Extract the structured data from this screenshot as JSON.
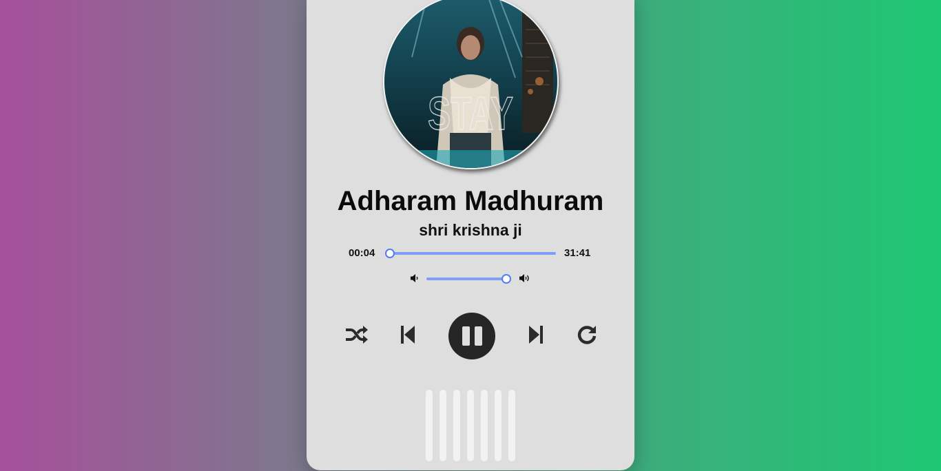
{
  "song": {
    "title": "Adharam Madhuram",
    "artist": "shri krishna ji",
    "cover_text": "STAY"
  },
  "progress": {
    "current": "00:04",
    "duration": "31:41",
    "fraction": 0.002
  },
  "volume": {
    "level": 1.0
  },
  "controls": [
    "shuffle-icon",
    "previous-icon",
    "pause-icon",
    "next-icon",
    "repeat-icon"
  ],
  "colors": {
    "accent": "#4f7ef0",
    "track": "#7f9ff6",
    "card": "#dedede",
    "button_dark": "#262626"
  }
}
